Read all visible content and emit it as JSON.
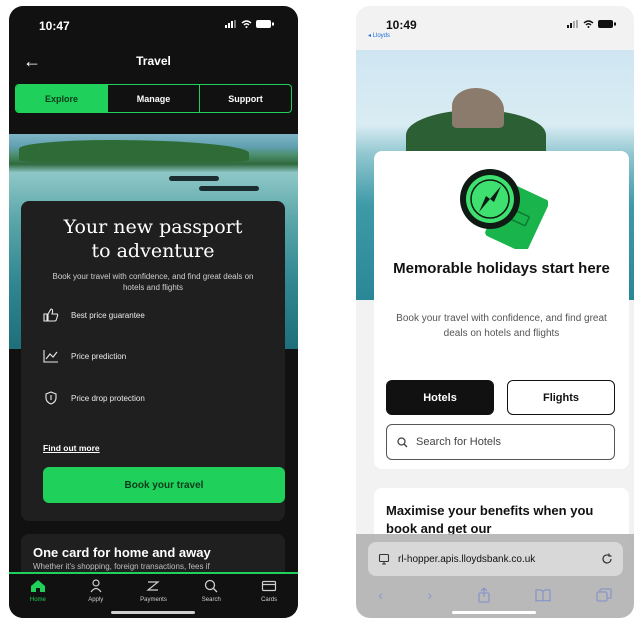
{
  "left": {
    "status": {
      "time": "10:47"
    },
    "nav": {
      "back_icon": "back-arrow-icon",
      "title": "Travel"
    },
    "tabs": [
      {
        "label": "Explore",
        "active": true
      },
      {
        "label": "Manage",
        "active": false
      },
      {
        "label": "Support",
        "active": false
      }
    ],
    "card": {
      "title_line1": "Your new passport",
      "title_line2": "to adventure",
      "subtitle": "Book your travel with confidence, and find great deals on hotels and flights",
      "features": [
        {
          "icon": "thumbs-up-icon",
          "label": "Best price guarantee"
        },
        {
          "icon": "chart-icon",
          "label": "Price prediction"
        },
        {
          "icon": "shield-icon",
          "label": "Price drop protection"
        }
      ],
      "link": "Find out more",
      "button": "Book your travel"
    },
    "card2": {
      "title": "One card for home and away",
      "subtitle": "Whether it's shopping, foreign transactions, fees if"
    },
    "tabbar": [
      {
        "label": "Home",
        "icon": "home-icon",
        "active": true
      },
      {
        "label": "Apply",
        "icon": "apply-icon",
        "active": false
      },
      {
        "label": "Payments",
        "icon": "payments-icon",
        "active": false
      },
      {
        "label": "Search",
        "icon": "search-icon",
        "active": false
      },
      {
        "label": "Cards",
        "icon": "cards-icon",
        "active": false
      }
    ],
    "colors": {
      "accent": "#1fd05a",
      "background": "#111111",
      "card": "#1f1f1f"
    }
  },
  "right": {
    "status": {
      "time": "10:49",
      "back_app": "◂ Lloyds"
    },
    "card": {
      "illustration": "passport-compass-icon",
      "heading": "Memorable holidays start here",
      "subtitle": "Book your travel with confidence, and find great deals on hotels and flights",
      "buttons": {
        "hotels": "Hotels",
        "flights": "Flights"
      },
      "search_placeholder": "Search for Hotels"
    },
    "card2": {
      "title": "Maximise your benefits when you book and get our"
    },
    "browser": {
      "url": "rl-hopper.apis.lloydsbank.co.uk",
      "tools": [
        "back-icon",
        "forward-icon",
        "share-icon",
        "bookmarks-icon",
        "tabs-icon"
      ]
    },
    "colors": {
      "accent": "#1fd05a",
      "dark_button": "#111111"
    }
  }
}
